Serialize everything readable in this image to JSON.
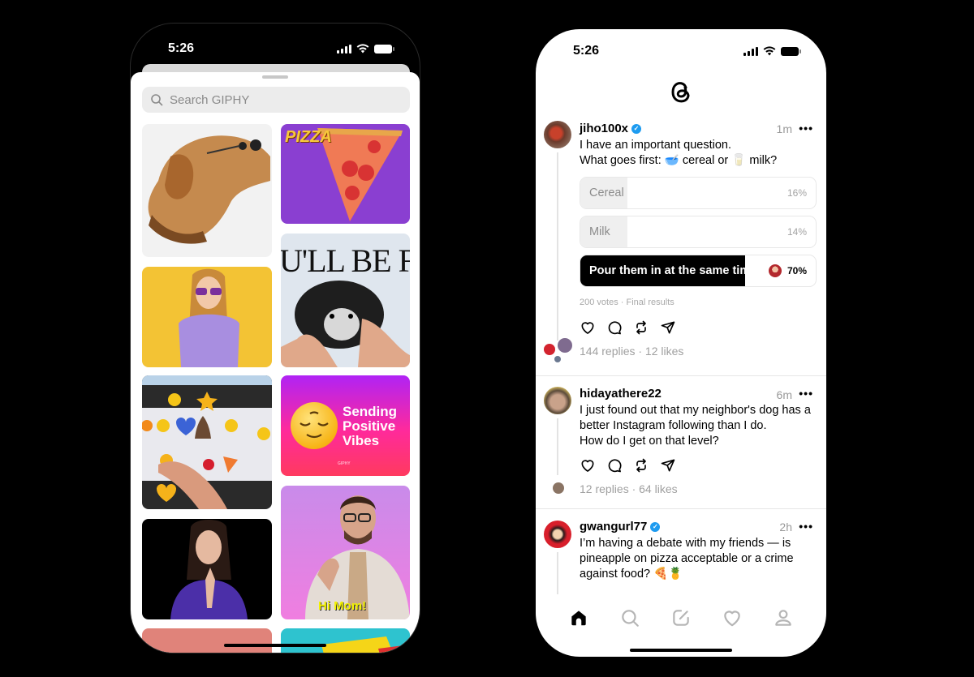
{
  "left_phone": {
    "status_bar": {
      "time": "5:26"
    },
    "search": {
      "placeholder": "Search GIPHY"
    },
    "gifs": [
      {
        "id": "dog",
        "description": "Dog wearing round sunglasses"
      },
      {
        "id": "pizza",
        "description": "Pizza slice on purple",
        "caption": "PIZZA"
      },
      {
        "id": "girl",
        "description": "Girl with purple sunglasses"
      },
      {
        "id": "pom",
        "description": "Pomeranian dog held by hands",
        "caption": "U'LL BE FI"
      },
      {
        "id": "emoji",
        "description": "Emoji toys on a board"
      },
      {
        "id": "vibes",
        "description": "Relieved emoji",
        "caption": "Sending Positive Vibes",
        "watermark": "GIPHY"
      },
      {
        "id": "woman",
        "description": "Woman clapping"
      },
      {
        "id": "mom",
        "description": "Man in ruffled shirt",
        "caption": "Hi Mom!"
      },
      {
        "id": "bottom-left",
        "description": "Partially visible GIF"
      },
      {
        "id": "bottom-right",
        "description": "Partially visible GIF"
      }
    ]
  },
  "right_phone": {
    "status_bar": {
      "time": "5:26"
    },
    "app": "Threads",
    "posts": [
      {
        "username": "jiho100x",
        "verified": true,
        "time": "1m",
        "lines": [
          "I have an important question.",
          "What goes first: 🥣 cereal or 🥛 milk?"
        ],
        "poll": {
          "options": [
            {
              "label": "Cereal",
              "percent_label": "16%",
              "percent": 16
            },
            {
              "label": "Milk",
              "percent_label": "14%",
              "percent": 14
            },
            {
              "label": "Pour them in at the same time",
              "percent_label": "70%",
              "percent": 70,
              "winner": true
            }
          ],
          "summary": "200 votes · Final results"
        },
        "stats": "144 replies · 12 likes"
      },
      {
        "username": "hidayathere22",
        "verified": false,
        "time": "6m",
        "lines": [
          "I just found out that my neighbor's dog has a",
          "better Instagram following than I do.",
          "How do I get on that level?"
        ],
        "stats": "12 replies · 64 likes"
      },
      {
        "username": "gwangurl77",
        "verified": true,
        "time": "2h",
        "lines": [
          "I’m having a debate with my friends — is",
          "pineapple on pizza acceptable or a crime",
          "against food? 🍕🍍"
        ]
      }
    ],
    "more_label": "•••",
    "verified_glyph": "✓",
    "tabs": [
      "home",
      "search",
      "compose",
      "activity",
      "profile"
    ],
    "colors": {
      "verified": "#1d9bf0",
      "winner_fill": "#000000",
      "muted_text": "#a0a0a0"
    }
  }
}
